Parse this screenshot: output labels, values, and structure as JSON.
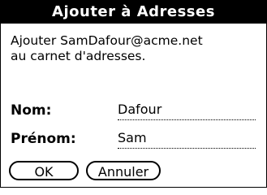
{
  "dialog": {
    "title": "Ajouter à Adresses",
    "message_line1": "Ajouter SamDafour@acme.net",
    "message_line2": "au carnet d'adresses."
  },
  "fields": {
    "last_name_label": "Nom:",
    "last_name_value": "Dafour",
    "first_name_label": "Prénom:",
    "first_name_value": "Sam"
  },
  "buttons": {
    "ok_label": "OK",
    "cancel_label": "Annuler"
  },
  "colors": {
    "titlebar_bg": "#000000",
    "titlebar_text": "#ffffff",
    "background": "#ffffff"
  }
}
